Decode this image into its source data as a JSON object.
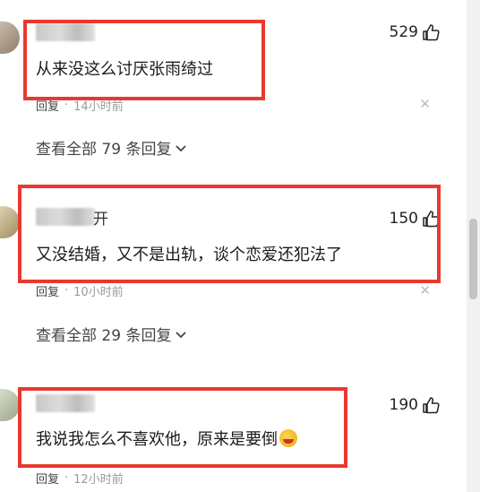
{
  "comments": [
    {
      "username_tail": "",
      "likes": "529",
      "text": "从来没这么讨厌张雨绮过",
      "reply_label": "回复",
      "time": "14小时前",
      "view_replies": "查看全部 79 条回复"
    },
    {
      "username_tail": "开",
      "likes": "150",
      "text": "又没结婚，又不是出轨，谈个恋爱还犯法了",
      "reply_label": "回复",
      "time": "10小时前",
      "view_replies": "查看全部 29 条回复"
    },
    {
      "username_tail": "",
      "likes": "190",
      "text": "我说我怎么不喜欢他，原来是要倒",
      "reply_label": "回复",
      "time": "12小时前",
      "view_replies": ""
    }
  ],
  "icons": {
    "like": "thumbs-up-icon",
    "close": "close-icon",
    "chevron": "chevron-down-icon",
    "emoji": "laughing-crying-emoji"
  },
  "colors": {
    "highlight_border": "#e8392f"
  }
}
